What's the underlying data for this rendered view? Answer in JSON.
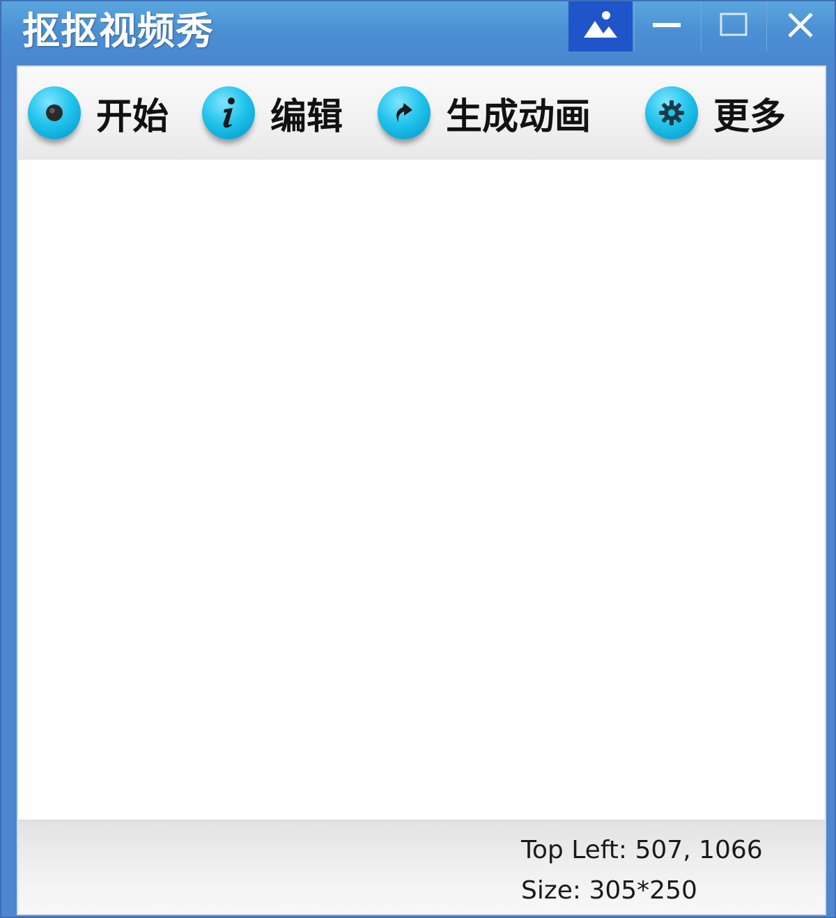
{
  "window": {
    "title": "抠抠视频秀"
  },
  "titlebar_buttons": {
    "skin_icon": "picture-icon",
    "minimize_icon": "minimize-icon",
    "maximize_icon": "maximize-icon",
    "close_icon": "close-icon"
  },
  "toolbar": {
    "items": [
      {
        "label": "开始",
        "icon": "record-icon"
      },
      {
        "label": "编辑",
        "icon": "info-icon"
      },
      {
        "label": "生成动画",
        "icon": "redo-arrow-icon"
      },
      {
        "label": "更多",
        "icon": "gear-icon"
      }
    ]
  },
  "status": {
    "top_left": "Top Left: 507, 1066",
    "size": "Size: 305*250"
  },
  "colors": {
    "titlebar": "#4b8fd3",
    "skin_button": "#1f55c8",
    "tool_icon": "#22c4ec"
  }
}
